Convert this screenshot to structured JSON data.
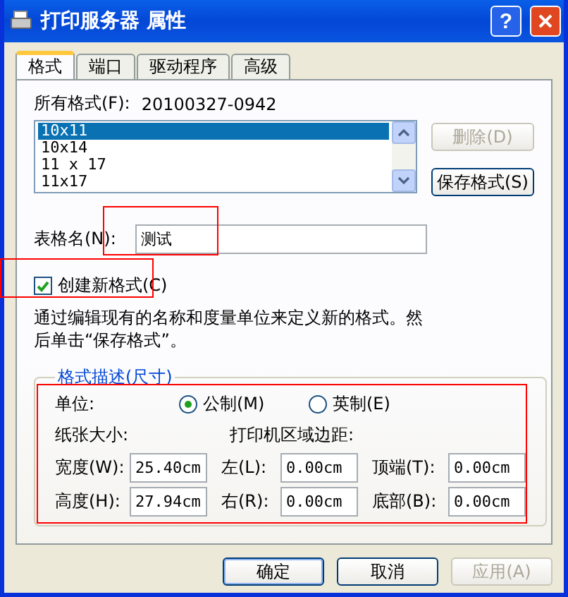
{
  "window": {
    "title": "打印服务器 属性",
    "help": "?"
  },
  "tabs": [
    {
      "label": "格式",
      "selected": true
    },
    {
      "label": "端口",
      "selected": false
    },
    {
      "label": "驱动程序",
      "selected": false
    },
    {
      "label": "高级",
      "selected": false
    }
  ],
  "formats": {
    "label": "所有格式(F):",
    "value": "20100327-0942",
    "items": [
      {
        "label": "10x11",
        "selected": true
      },
      {
        "label": "10x14",
        "selected": false
      },
      {
        "label": "11 x 17",
        "selected": false
      },
      {
        "label": "11x17",
        "selected": false
      }
    ],
    "buttons": [
      {
        "label": "删除(D)",
        "disabled": true
      },
      {
        "label": "保存格式(S)",
        "disabled": false
      }
    ]
  },
  "form_name": {
    "label": "表格名(N):",
    "value": "测试"
  },
  "create_new": {
    "label": "创建新格式(C)",
    "checked": true
  },
  "description": "通过编辑现有的名称和度量单位来定义新的格式。然后单击“保存格式”。",
  "group": {
    "title": "格式描述(尺寸)",
    "units_label": "单位:",
    "units": [
      {
        "label": "公制(M)",
        "selected": true
      },
      {
        "label": "英制(E)",
        "selected": false
      }
    ],
    "paper_label": "纸张大小:",
    "margins_label": "打印机区域边距:",
    "rows": [
      [
        {
          "label": "宽度(W):",
          "value": "25.40cm"
        },
        {
          "label": "左(L):",
          "value": "0.00cm"
        },
        {
          "label": "顶端(T):",
          "value": "0.00cm"
        }
      ],
      [
        {
          "label": "高度(H):",
          "value": "27.94cm"
        },
        {
          "label": "右(R):",
          "value": "0.00cm"
        },
        {
          "label": "底部(B):",
          "value": "0.00cm"
        }
      ]
    ]
  },
  "footer": [
    {
      "label": "确定",
      "disabled": false,
      "default": true
    },
    {
      "label": "取消",
      "disabled": false,
      "default": false
    },
    {
      "label": "应用(A)",
      "disabled": true,
      "default": false
    }
  ]
}
